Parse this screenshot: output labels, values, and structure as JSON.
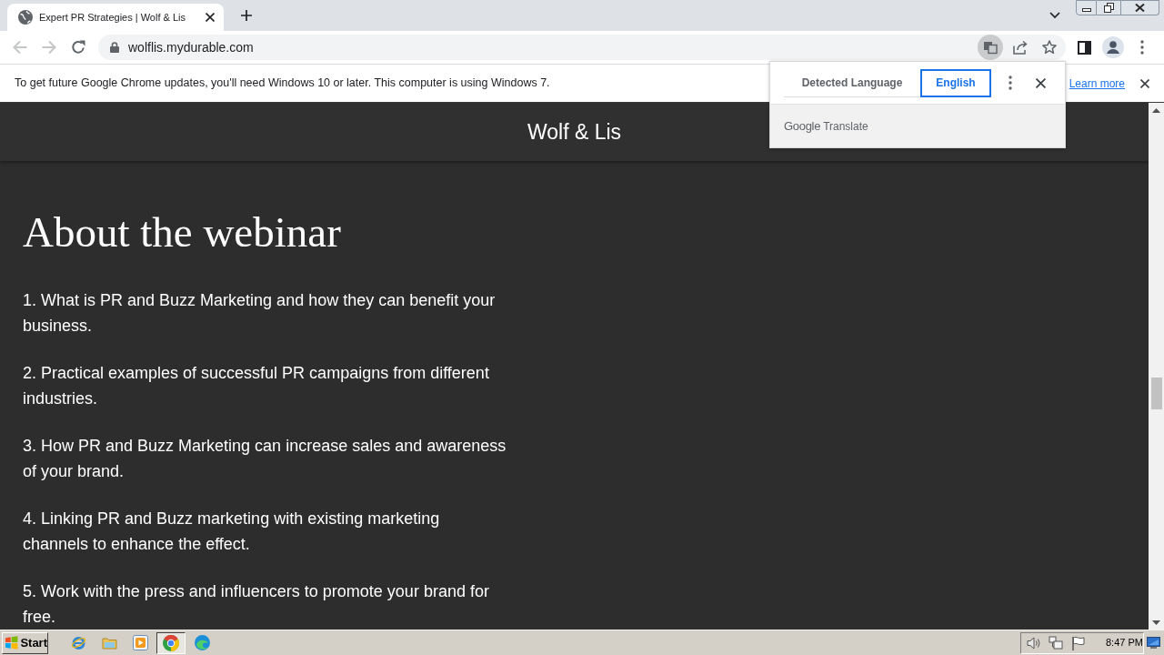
{
  "browser": {
    "tabs": [
      {
        "title": "Expert PR Strategies | Wolf & Lis",
        "selected": true
      }
    ],
    "nav": [
      {
        "kind": "back",
        "disabled": true
      },
      {
        "kind": "forward",
        "disabled": true
      },
      {
        "kind": "reload",
        "disabled": false
      }
    ],
    "address": "wolflis.mydurable.com"
  },
  "infobar": {
    "message": "To get future Google Chrome updates, you'll need Windows 10 or later. This computer is using Windows 7.",
    "link": "Learn more"
  },
  "translate_popup": {
    "tabs": [
      {
        "label": "Detected Language",
        "selected": false
      },
      {
        "label": "English",
        "selected": true
      }
    ],
    "brand": "Google",
    "product": "Translate"
  },
  "page": {
    "site_title": "Wolf & Lis",
    "heading": "About the webinar",
    "items": [
      "1. What is PR and Buzz Marketing and how they can benefit your business.",
      "2. Practical examples of successful PR campaigns from different industries.",
      "3. How PR and Buzz Marketing can increase sales and awareness of your brand.",
      "4. Linking PR and Buzz marketing with existing marketing channels to enhance the effect.",
      "5. Work with the press and influencers to promote your brand for free."
    ]
  },
  "taskbar": {
    "start": "Start",
    "apps": [
      {
        "kind": "ie",
        "selected": false
      },
      {
        "kind": "explorer",
        "selected": false
      },
      {
        "kind": "media",
        "selected": false
      },
      {
        "kind": "chrome",
        "selected": true
      },
      {
        "kind": "edge",
        "selected": false
      }
    ],
    "clock": "8:47 PM"
  }
}
